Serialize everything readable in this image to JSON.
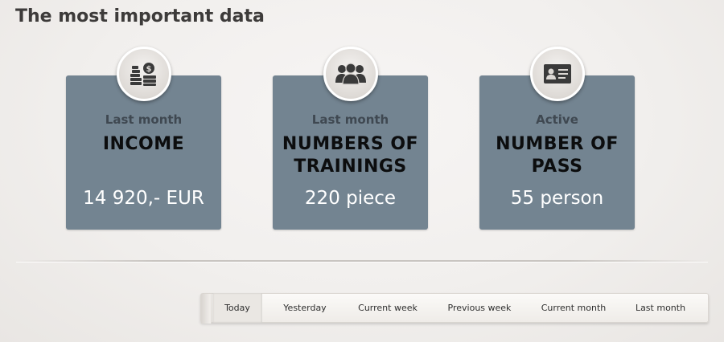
{
  "page": {
    "title": "The most important data"
  },
  "cards": [
    {
      "icon": "income-coins-icon",
      "subtitle": "Last month",
      "heading_line1": "INCOME",
      "heading_line2": "",
      "value": "14 920,- EUR"
    },
    {
      "icon": "group-people-icon",
      "subtitle": "Last month",
      "heading_line1": "NUMBERS OF",
      "heading_line2": "TRAININGS",
      "value": "220 piece"
    },
    {
      "icon": "id-card-icon",
      "subtitle": "Active",
      "heading_line1": "NUMBER OF",
      "heading_line2": "PASS",
      "value": "55 person"
    }
  ],
  "tabs": [
    {
      "label": "Today",
      "active": true
    },
    {
      "label": "Yesterday",
      "active": false
    },
    {
      "label": "Current week",
      "active": false
    },
    {
      "label": "Previous week",
      "active": false
    },
    {
      "label": "Current month",
      "active": false
    },
    {
      "label": "Last month",
      "active": false
    }
  ],
  "colors": {
    "card_background": "#738491",
    "heading_text": "#0c0d0e",
    "value_text": "#ffffff",
    "subtitle_text": "#3f4851",
    "title_text": "#3d3b3a"
  }
}
